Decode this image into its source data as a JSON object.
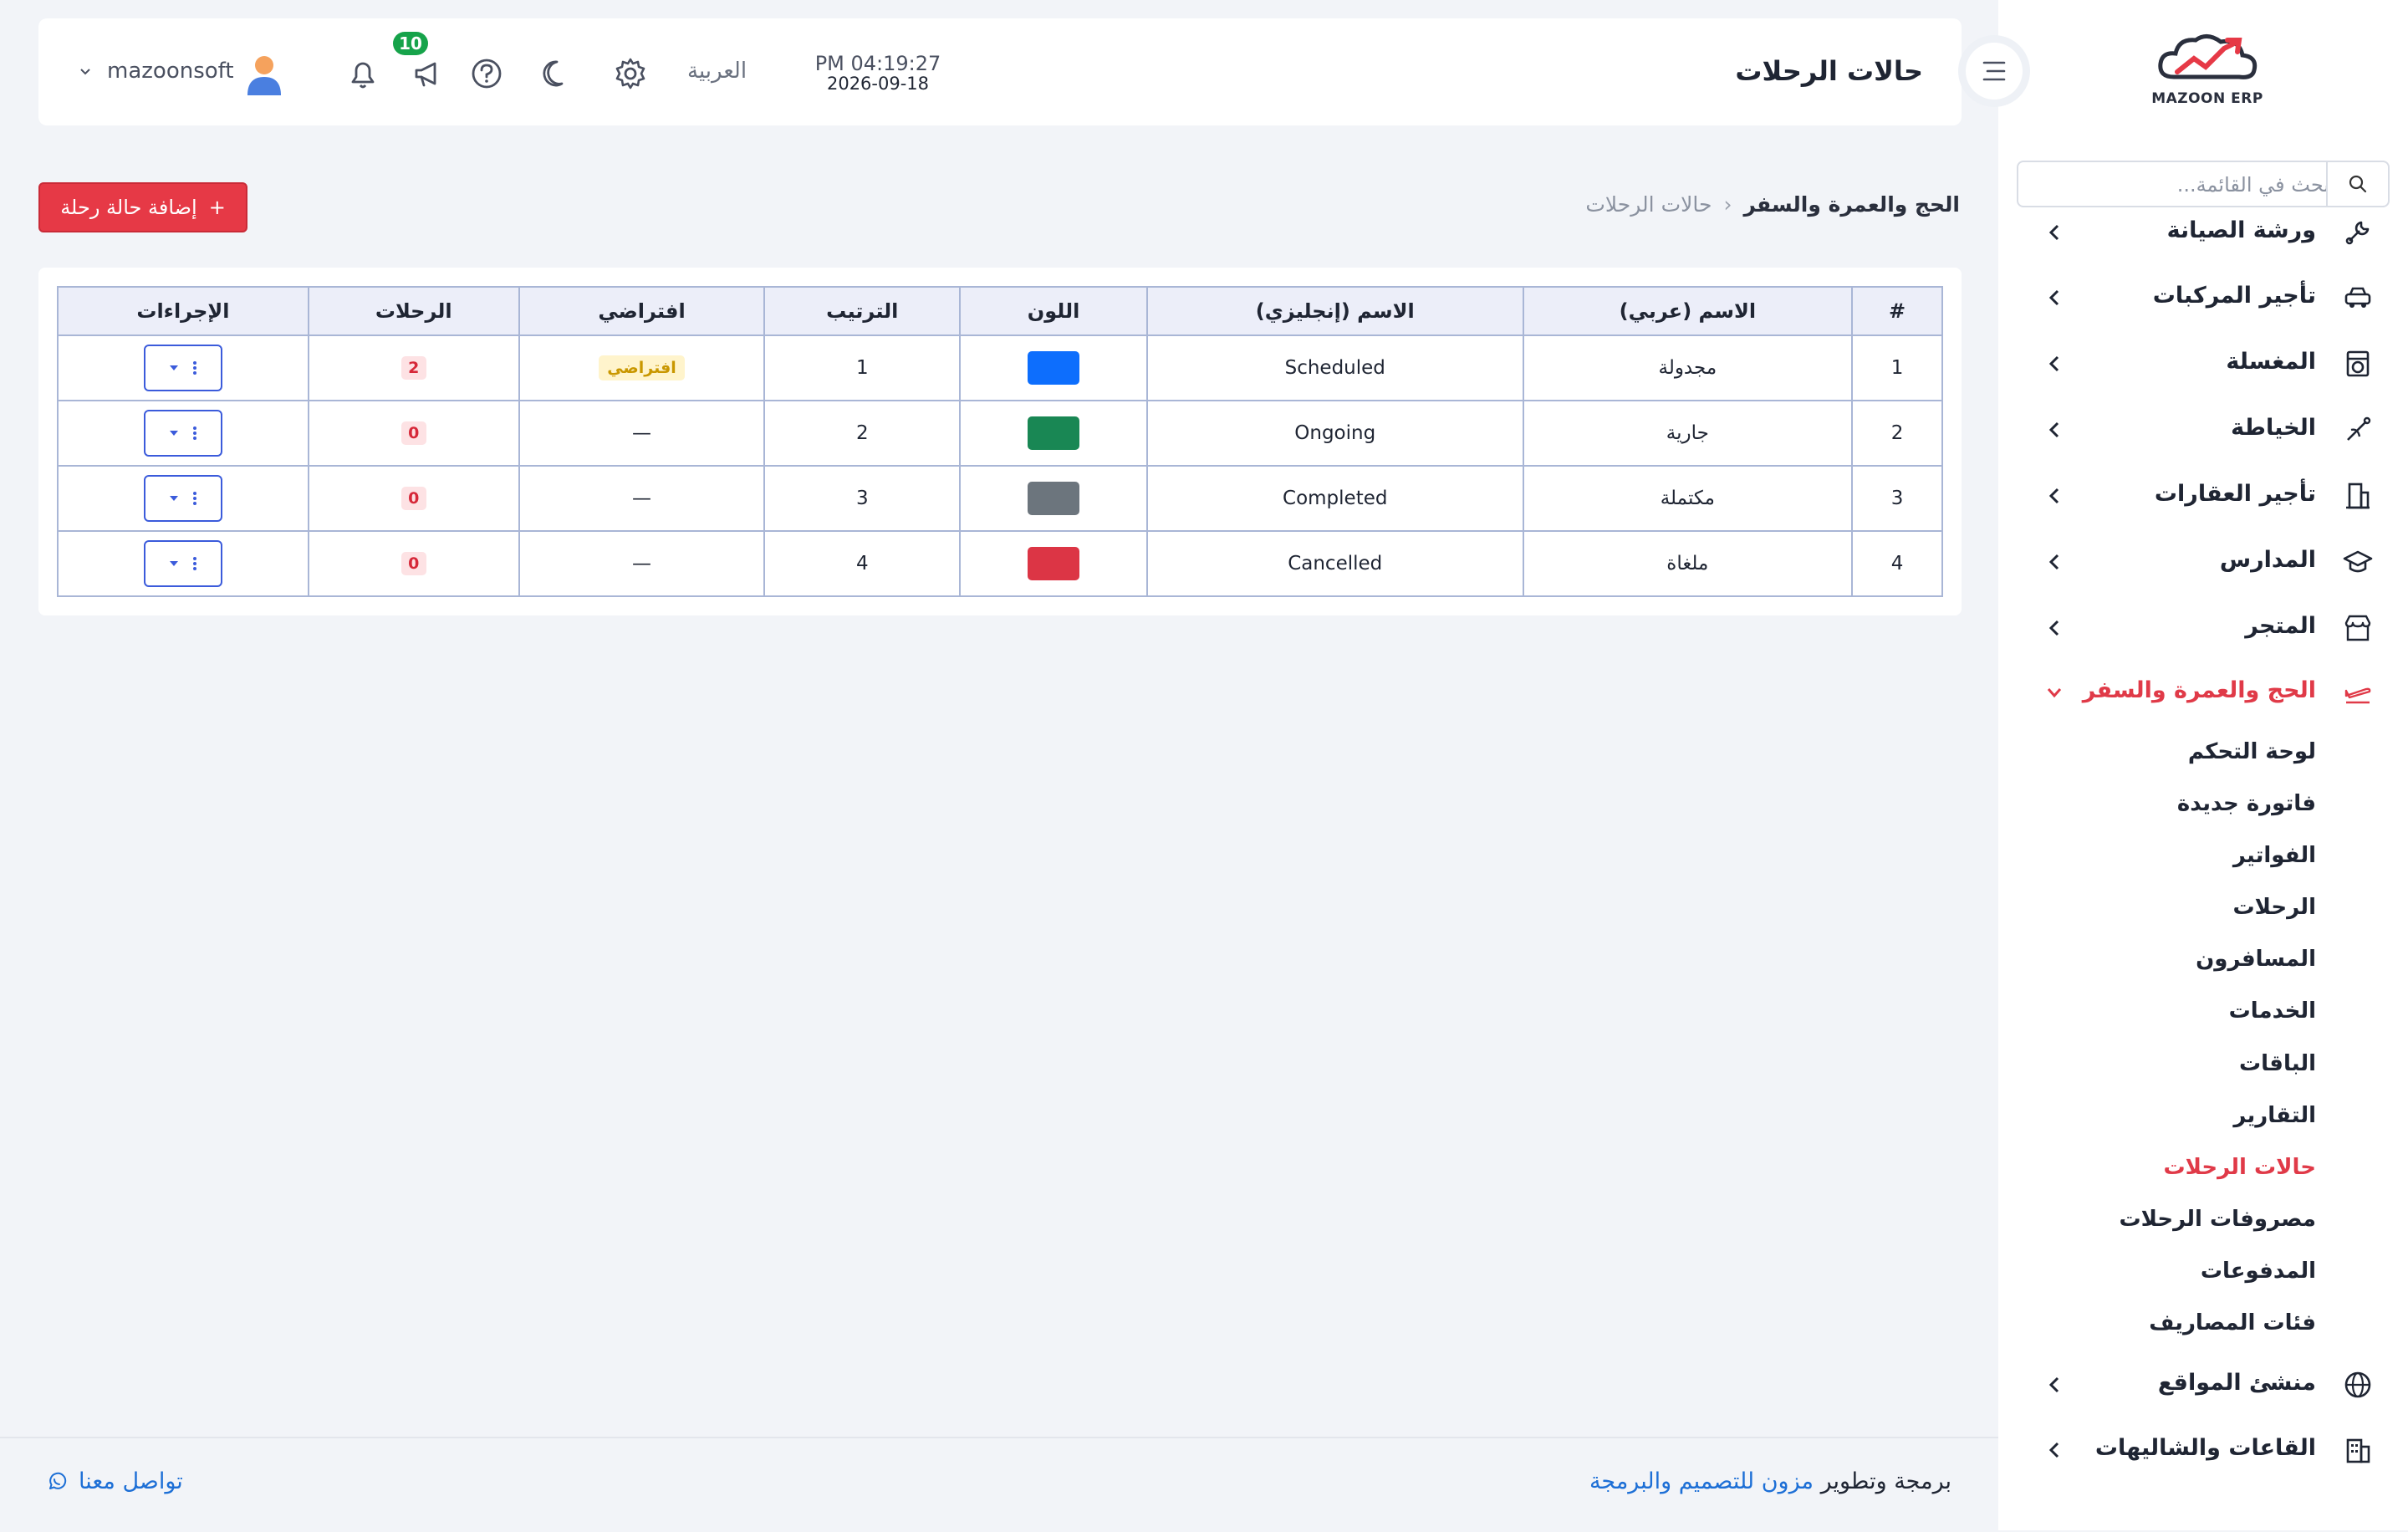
{
  "brand": {
    "name": "MAZOON ERP",
    "logo_tag": "ERP ERP"
  },
  "sidebar": {
    "search_placeholder": "بحث في القائمة...",
    "items": [
      {
        "label": "ورشة الصيانة",
        "icon": "wrench-icon"
      },
      {
        "label": "تأجير المركبات",
        "icon": "car-icon"
      },
      {
        "label": "المغسلة",
        "icon": "washer-icon"
      },
      {
        "label": "الخياطة",
        "icon": "sewing-icon"
      },
      {
        "label": "تأجير العقارات",
        "icon": "building-icon"
      },
      {
        "label": "المدارس",
        "icon": "graduation-cap-icon"
      },
      {
        "label": "المتجر",
        "icon": "store-icon"
      },
      {
        "label": "الحج والعمرة والسفر",
        "icon": "airplane-icon",
        "expanded": true
      },
      {
        "label": "منشئ المواقع",
        "icon": "globe-icon"
      },
      {
        "label": "القاعات والشاليهات",
        "icon": "hall-icon"
      }
    ],
    "subitems": [
      {
        "label": "لوحة التحكم"
      },
      {
        "label": "فاتورة جديدة"
      },
      {
        "label": "الفواتير"
      },
      {
        "label": "الرحلات"
      },
      {
        "label": "المسافرون"
      },
      {
        "label": "الخدمات"
      },
      {
        "label": "الباقات"
      },
      {
        "label": "التقارير"
      },
      {
        "label": "حالات الرحلات",
        "active": true
      },
      {
        "label": "مصروفات الرحلات"
      },
      {
        "label": "المدفوعات"
      },
      {
        "label": "فئات المصاريف"
      }
    ]
  },
  "header": {
    "title": "حالات الرحلات",
    "time": "PM 04:19:27",
    "date": "2026-09-18",
    "language": "العربية",
    "notifications_count": "10",
    "username": "mazoonsoft"
  },
  "breadcrumb": {
    "parent": "الحج والعمرة والسفر",
    "separator": "‹",
    "current": "حالات الرحلات"
  },
  "add_button": {
    "label": "إضافة حالة رحلة",
    "icon": "+"
  },
  "table": {
    "columns": [
      "#",
      "الاسم (عربي)",
      "الاسم (إنجليزي)",
      "اللون",
      "الترتيب",
      "افتراضي",
      "الرحلات",
      "الإجراءات"
    ],
    "rows": [
      {
        "num": "1",
        "name_ar": "مجدولة",
        "name_en": "Scheduled",
        "color": "#0d6efd",
        "order": "1",
        "default": "افتراضي",
        "trips": "2"
      },
      {
        "num": "2",
        "name_ar": "جارية",
        "name_en": "Ongoing",
        "color": "#198754",
        "order": "2",
        "default": "—",
        "trips": "0"
      },
      {
        "num": "3",
        "name_ar": "مكتملة",
        "name_en": "Completed",
        "color": "#6c757d",
        "order": "3",
        "default": "—",
        "trips": "0"
      },
      {
        "num": "4",
        "name_ar": "ملغاة",
        "name_en": "Cancelled",
        "color": "#dc3545",
        "order": "4",
        "default": "—",
        "trips": "0"
      }
    ]
  },
  "footer": {
    "credit_prefix": "برمجة وتطوير",
    "credit_company": "مزون للتصميم والبرمجة",
    "contact": "تواصل معنا"
  },
  "colors": {
    "accent": "#e63946",
    "link": "#1d6fd6",
    "table_border": "#a9b6d6",
    "notification": "#16a34a"
  }
}
